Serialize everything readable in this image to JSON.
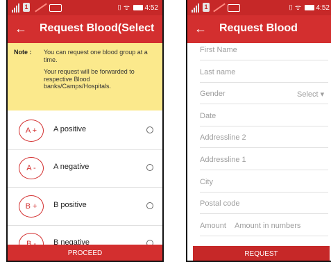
{
  "left_screen": {
    "status": {
      "sim": "1",
      "time": "4:52",
      "icons": "⌷ ᯤ"
    },
    "appbar": {
      "back_icon": "←",
      "title": "Request Blood(Select Bl..."
    },
    "note": {
      "label": "Note :",
      "line1": "You can request one blood group at a time.",
      "line2": "Your request will be forwarded to respective Blood banks/Camps/Hospitals."
    },
    "blood_groups": [
      {
        "code": "A +",
        "label": "A positive"
      },
      {
        "code": "A -",
        "label": "A negative"
      },
      {
        "code": "B +",
        "label": "B positive"
      },
      {
        "code": "B -",
        "label": "B negative"
      }
    ],
    "proceed_label": "PROCEED"
  },
  "right_screen": {
    "status": {
      "sim": "1",
      "time": "4:52",
      "icons": "⌷ ᯤ"
    },
    "appbar": {
      "back_icon": "←",
      "title": "Request Blood"
    },
    "fields": {
      "first_name": "First Name",
      "last_name": "Last name",
      "gender": "Gender",
      "gender_select": "Select ▾",
      "date": "Date",
      "address2": "Addressline 2",
      "address1": "Addressline 1",
      "city": "City",
      "postal": "Postal code",
      "amount": "Amount",
      "amount_placeholder": "Amount in numbers"
    },
    "request_label": "REQUEST"
  },
  "colors": {
    "primary": "#d32f2f",
    "status_bar": "#c62828",
    "note_bg": "#fbe98c"
  }
}
